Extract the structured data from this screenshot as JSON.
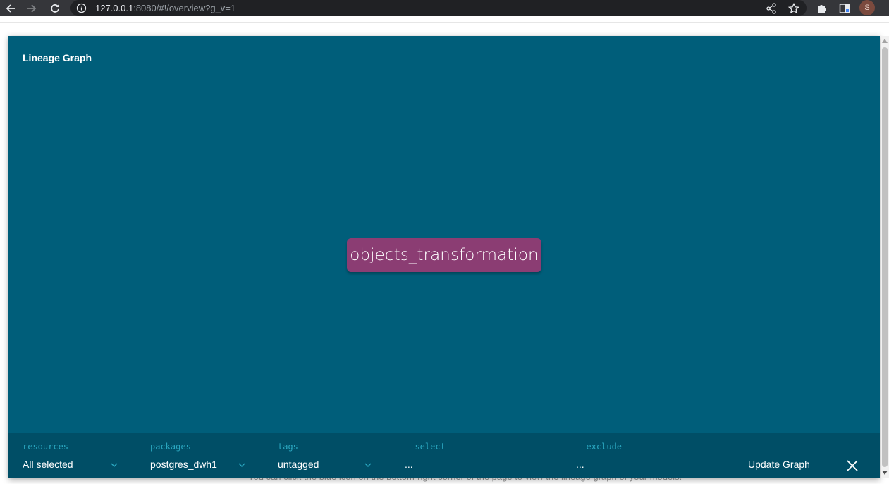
{
  "browser": {
    "url_host": "127.0.0.1",
    "url_rest": ":8080/#!/overview?g_v=1",
    "profile_initial": "S"
  },
  "page": {
    "background_text": "You can click the blue icon on the bottom-right corner of the page to view the lineage graph of your models."
  },
  "modal": {
    "title": "Lineage Graph",
    "background_color": "#005e7a",
    "node": {
      "label": "objects_transformation",
      "color": "#8b3d73"
    },
    "footer": {
      "resources": {
        "label": "resources",
        "value": "All selected"
      },
      "packages": {
        "label": "packages",
        "value": "postgres_dwh1"
      },
      "tags": {
        "label": "tags",
        "value": "untagged"
      },
      "select": {
        "label": "--select",
        "value": "..."
      },
      "exclude": {
        "label": "--exclude",
        "value": "..."
      },
      "update_label": "Update Graph",
      "label_color": "#2aa7c0"
    }
  }
}
